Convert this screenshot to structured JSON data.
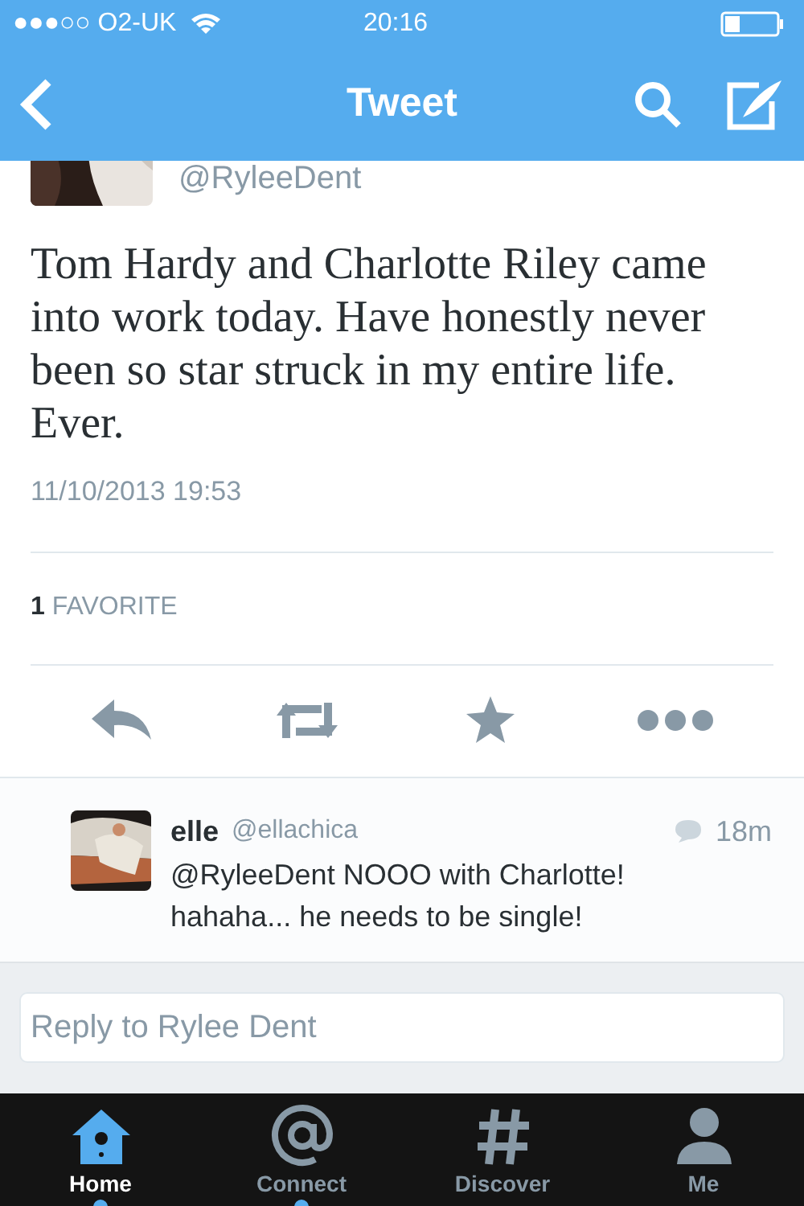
{
  "status_bar": {
    "carrier": "●●●○○ O2-UK",
    "time": "20:16"
  },
  "nav": {
    "title": "Tweet"
  },
  "tweet": {
    "handle": "@RyleeDent",
    "text": "Tom Hardy and Charlotte Riley came into work today. Have honestly never been so star struck in my entire life. Ever.",
    "timestamp": "11/10/2013 19:53",
    "favorites_count": "1",
    "favorites_label": "FAVORITE"
  },
  "actions": [
    {
      "kind": "reply"
    },
    {
      "kind": "retweet"
    },
    {
      "kind": "favorite"
    },
    {
      "kind": "more"
    }
  ],
  "replies": [
    {
      "name": "elle",
      "handle": "@ellachica",
      "time": "18m",
      "text": "@RyleeDent NOOO with Charlotte! hahaha... he needs to be single!"
    }
  ],
  "reply_box": {
    "placeholder": "Reply to Rylee Dent"
  },
  "tab_bar": [
    {
      "kind": "home",
      "label": "Home",
      "selected": true,
      "unread": true
    },
    {
      "kind": "connect",
      "label": "Connect",
      "selected": false,
      "unread": true
    },
    {
      "kind": "discover",
      "label": "Discover",
      "selected": false,
      "unread": false
    },
    {
      "kind": "me",
      "label": "Me",
      "selected": false,
      "unread": false
    }
  ]
}
